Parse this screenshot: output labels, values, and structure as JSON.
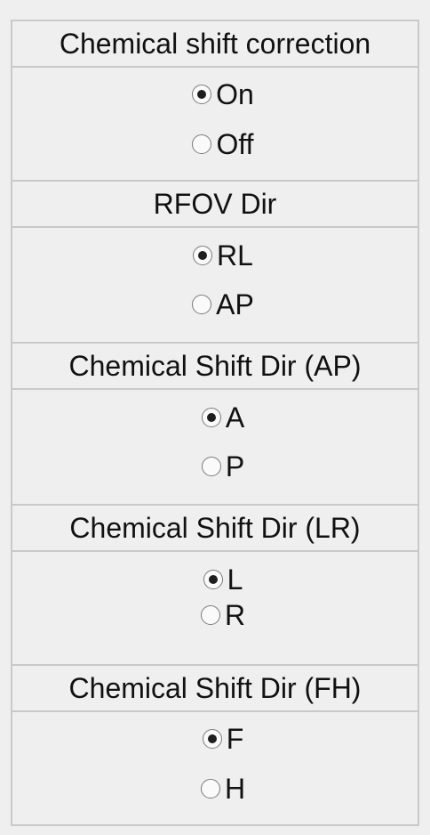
{
  "groups": [
    {
      "title": "Chemical shift correction",
      "options": [
        {
          "label": "On",
          "checked": true
        },
        {
          "label": "Off",
          "checked": false
        }
      ]
    },
    {
      "title": "RFOV Dir",
      "options": [
        {
          "label": "RL",
          "checked": true
        },
        {
          "label": "AP",
          "checked": false
        }
      ]
    },
    {
      "title": "Chemical Shift Dir (AP)",
      "options": [
        {
          "label": "A",
          "checked": true
        },
        {
          "label": "P",
          "checked": false
        }
      ]
    },
    {
      "title": "Chemical Shift Dir (LR)",
      "options": [
        {
          "label": "L",
          "checked": true
        },
        {
          "label": "R",
          "checked": false
        }
      ]
    },
    {
      "title": "Chemical Shift Dir (FH)",
      "options": [
        {
          "label": "F",
          "checked": true
        },
        {
          "label": "H",
          "checked": false
        }
      ]
    }
  ]
}
